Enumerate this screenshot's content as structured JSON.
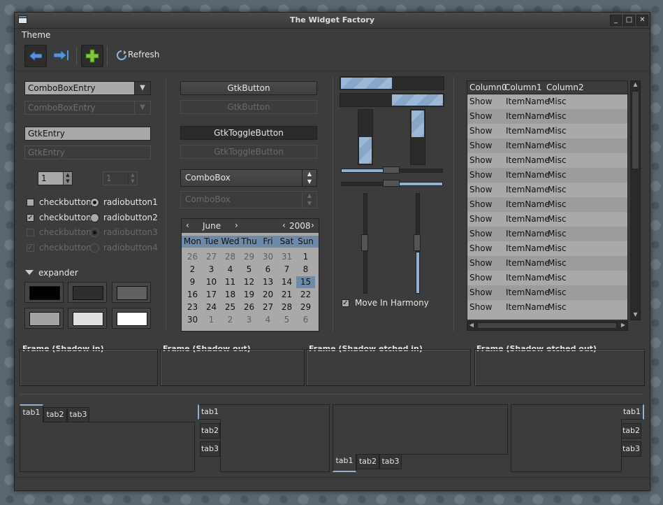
{
  "window": {
    "title": "The Widget Factory"
  },
  "menu": {
    "theme": "Theme"
  },
  "toolbar": {
    "refresh_label": "Refresh",
    "back_icon": "arrow-left-icon",
    "forward_icon": "arrow-right-icon",
    "add_icon": "plus-icon"
  },
  "left": {
    "combo_entry": "ComboBoxEntry",
    "combo_entry_disabled": "ComboBoxEntry",
    "entry": "GtkEntry",
    "entry_disabled": "GtkEntry",
    "spin": "1",
    "spin_disabled": "1",
    "check1": "checkbutton1",
    "check2": "checkbutton2",
    "check3": "checkbutton3",
    "check4": "checkbutton4",
    "radio1": "radiobutton1",
    "radio2": "radiobutton2",
    "radio3": "radiobutton3",
    "radio4": "radiobutton4",
    "expander": "expander",
    "colors": [
      "#000000",
      "#2e2e2e",
      "#606060",
      "#a3a3a3",
      "#e0e0e0",
      "#ffffff"
    ]
  },
  "middle": {
    "button": "GtkButton",
    "button_disabled": "GtkButton",
    "toggle": "GtkToggleButton",
    "toggle_disabled": "GtkToggleButton",
    "combo": "ComboBox",
    "combo_disabled": "ComboBox",
    "calendar": {
      "month": "June",
      "year": "2008",
      "days": [
        "Mon",
        "Tue",
        "Wed",
        "Thu",
        "Fri",
        "Sat",
        "Sun"
      ],
      "weeks": [
        [
          "26",
          "27",
          "28",
          "29",
          "30",
          "31",
          "1"
        ],
        [
          "2",
          "3",
          "4",
          "5",
          "6",
          "7",
          "8"
        ],
        [
          "9",
          "10",
          "11",
          "12",
          "13",
          "14",
          "15"
        ],
        [
          "16",
          "17",
          "18",
          "19",
          "20",
          "21",
          "22"
        ],
        [
          "23",
          "24",
          "25",
          "26",
          "27",
          "28",
          "29"
        ],
        [
          "30",
          "1",
          "2",
          "3",
          "4",
          "5",
          "6"
        ]
      ],
      "selected": "15"
    }
  },
  "sliders": {
    "progress_h1": 0.5,
    "progress_h2": 0.5,
    "progress_v1": 0.5,
    "progress_v2": 0.5,
    "scale_h1": 0.5,
    "scale_h2": 0.5,
    "scale_v1": 0.5,
    "scale_v2": 0.5,
    "harmony": "Move In Harmony"
  },
  "tree": {
    "columns": [
      "Column0",
      "Column1",
      "Column2"
    ],
    "rows": [
      [
        "Show",
        "ItemName",
        "Misc"
      ],
      [
        "Show",
        "ItemName",
        "Misc"
      ],
      [
        "Show",
        "ItemName",
        "Misc"
      ],
      [
        "Show",
        "ItemName",
        "Misc"
      ],
      [
        "Show",
        "ItemName",
        "Misc"
      ],
      [
        "Show",
        "ItemName",
        "Misc"
      ],
      [
        "Show",
        "ItemName",
        "Misc"
      ],
      [
        "Show",
        "ItemName",
        "Misc"
      ],
      [
        "Show",
        "ItemName",
        "Misc"
      ],
      [
        "Show",
        "ItemName",
        "Misc"
      ],
      [
        "Show",
        "ItemName",
        "Misc"
      ],
      [
        "Show",
        "ItemName",
        "Misc"
      ],
      [
        "Show",
        "ItemName",
        "Misc"
      ],
      [
        "Show",
        "ItemName",
        "Misc"
      ],
      [
        "Show",
        "ItemName",
        "Misc"
      ]
    ]
  },
  "frames": [
    "Frame (Shadow in)",
    "Frame (Shadow out)",
    "Frame (Shadow etched in)",
    "Frame (Shadow etched out)"
  ],
  "tabs": [
    "tab1",
    "tab2",
    "tab3"
  ],
  "colors": {
    "accent": "#8fb1d3",
    "bg": "#3c3c3c"
  }
}
